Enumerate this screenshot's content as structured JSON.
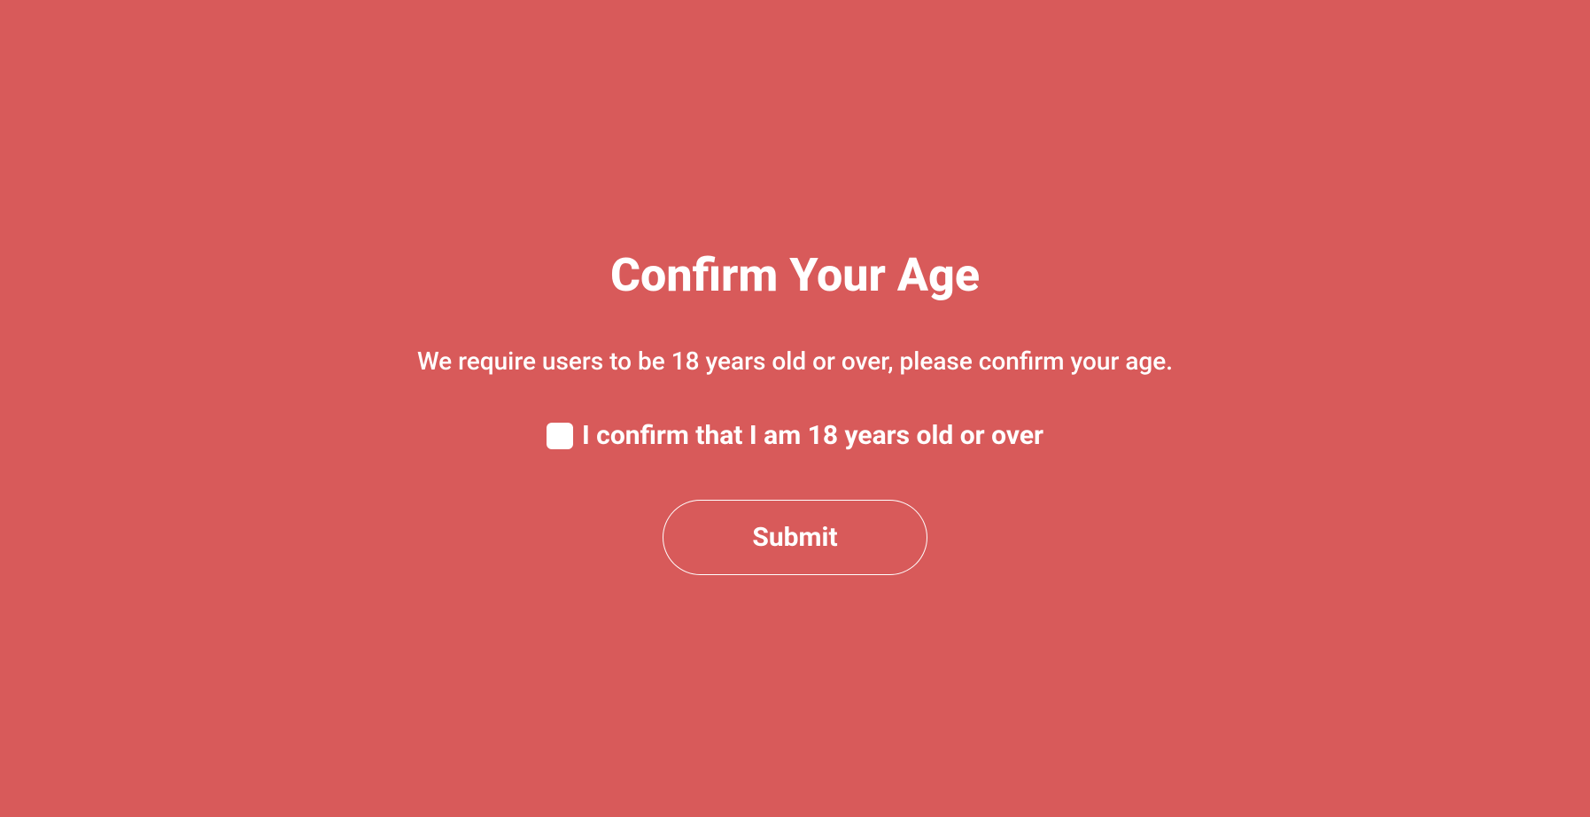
{
  "dialog": {
    "title": "Confirm Your Age",
    "description": "We require users to be 18 years old or over, please confirm your age.",
    "checkbox_label": "I confirm that I am 18 years old or over",
    "checkbox_checked": false,
    "submit_label": "Submit"
  }
}
